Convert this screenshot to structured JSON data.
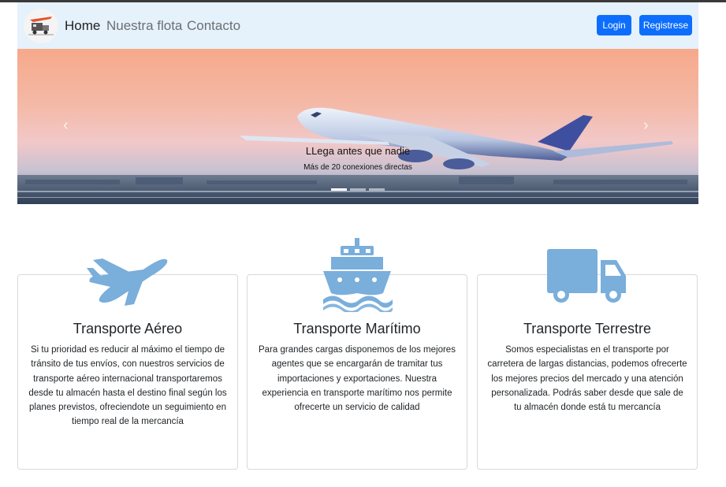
{
  "navbar": {
    "links": [
      {
        "label": "Home",
        "active": true
      },
      {
        "label": "Nuestra flota",
        "active": false
      },
      {
        "label": "Contacto",
        "active": false
      }
    ],
    "buttons": {
      "login": "Login",
      "register": "Registrese"
    }
  },
  "carousel": {
    "title": "LLega antes que nadie",
    "subtitle": "Más de 20 conexiones directas",
    "prev_icon": "chevron-left-icon",
    "next_icon": "chevron-right-icon",
    "slide_count": 3,
    "active_slide": 1
  },
  "services": [
    {
      "icon": "airplane-icon",
      "title": "Transporte Aéreo",
      "text": "Si tu prioridad es reducir al máximo el tiempo de tránsito de tus envíos, con nuestros servicios de transporte aéreo internacional transportaremos desde tu almacén hasta el destino final según los planes previstos, ofreciendote un seguimiento en tiempo real de la mercancía"
    },
    {
      "icon": "ship-icon",
      "title": "Transporte Marítimo",
      "text": "Para grandes cargas disponemos de los mejores agentes que se encargarán de tramitar tus importaciones y exportaciones. Nuestra experiencia en transporte marítimo nos permite ofrecerte un servicio de calidad"
    },
    {
      "icon": "truck-icon",
      "title": "Transporte Terrestre",
      "text": "Somos especialistas en el transporte por carretera de largas distancias, podemos ofrecerte los mejores precios del mercado y una atención personalizada. Podrás saber desde que sale de tu almacén donde está tu mercancía"
    }
  ],
  "colors": {
    "brand": "#0d6efd",
    "icon": "#7aaedb",
    "navbar_bg": "#e5f1fb"
  }
}
